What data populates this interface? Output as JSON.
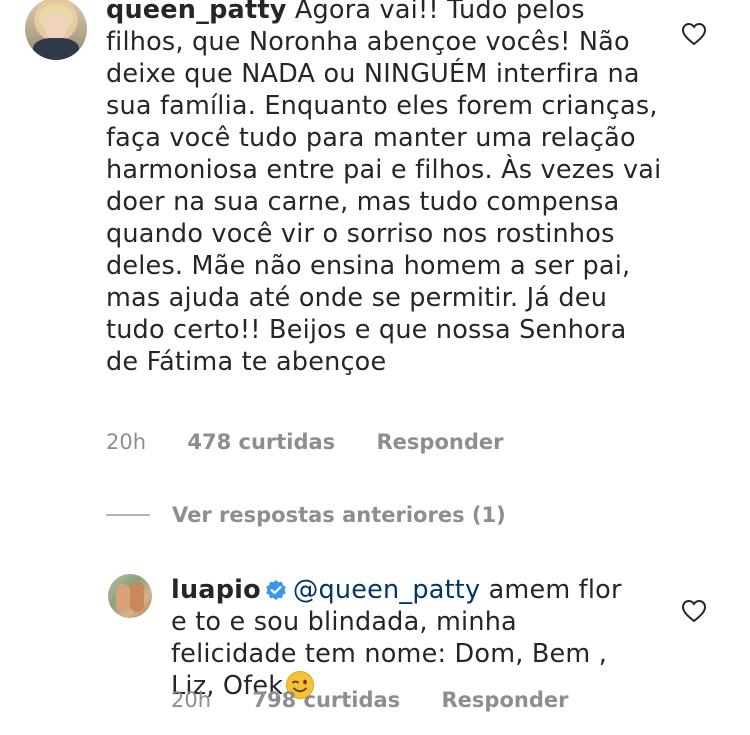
{
  "comment": {
    "username": "queen_patty",
    "text": "Agora vai!! Tudo pelos filhos, que Noronha abençoe vocês! Não deixe que NADA ou NINGUÉM interfira na sua família. Enquanto eles forem crianças, faça você tudo para manter uma relação harmoniosa entre pai e filhos. Às vezes vai doer na sua carne, mas tudo compensa quando você vir o sorriso nos rostinhos deles. Mãe não ensina homem a ser pai, mas ajuda até onde se permitir. Já deu tudo certo!! Beijos e que nossa Senhora de Fátima te abençoe",
    "time": "20h",
    "likes": "478 curtidas",
    "reply_label": "Responder"
  },
  "view_replies": {
    "label": "Ver respostas anteriores (1)"
  },
  "reply": {
    "username": "luapio",
    "mention": "@queen_patty",
    "text": "amem flor e to e sou blindada, minha felicidade tem nome: Dom, Bem , Liz, Ofek",
    "time": "20h",
    "likes": "798 curtidas",
    "reply_label": "Responder"
  },
  "icons": {
    "heart": "heart-outline-icon",
    "verified": "verified-badge-icon",
    "emoji": "winking-face-emoji"
  },
  "colors": {
    "text": "#262626",
    "meta": "#8e8e8e",
    "mention": "#00376b",
    "verified": "#3897f0"
  }
}
